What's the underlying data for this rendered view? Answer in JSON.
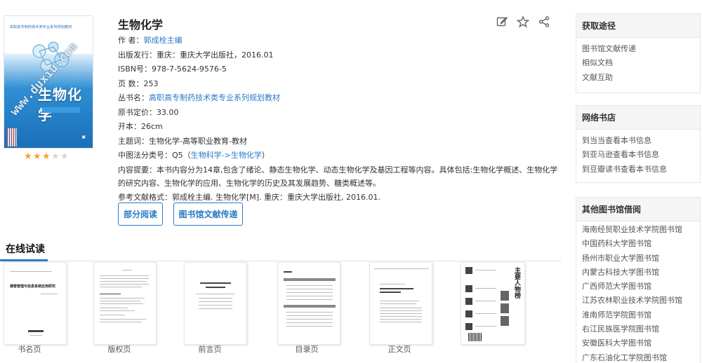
{
  "book": {
    "title": "生物化学",
    "rating": {
      "value": 3,
      "max": 5
    },
    "cover": {
      "series_text": "高职高专制药技术类专业系列规划教材",
      "title": "生物化学",
      "watermark": "www.duxiu.com"
    },
    "author": {
      "label": "作 者：",
      "value": "郭成栓主编"
    },
    "publisher": {
      "label": "出版发行：",
      "value": "重庆：重庆大学出版社，2016.01"
    },
    "isbn": {
      "label": "ISBN号：",
      "value": "978-7-5624-9576-5"
    },
    "pages": {
      "label": "页 数：",
      "value": "253"
    },
    "series": {
      "label": "丛书名：",
      "value": "高职高专制药技术类专业系列规划教材"
    },
    "price": {
      "label": "原书定价：",
      "value": "33.00"
    },
    "format": {
      "label": "开本：",
      "value": "26cm"
    },
    "subject": {
      "label": "主题词：",
      "value": "生物化学-高等职业教育-教材"
    },
    "classification": {
      "label": "中图法分类号：",
      "code": "Q5",
      "open": "（",
      "cat1": "生物科学",
      "arrow": "->",
      "cat2": "生物化学",
      "close": "）"
    },
    "summary": {
      "label": "内容提要：",
      "value": "本书内容分为14章,包含了绪论、静态生物化学、动态生物化学及基因工程等内容。具体包括:生物化学概述、生物化学的研究内容、生物化学的应用、生物化学的历史及其发展趋势、糖类概述等。"
    },
    "citation": {
      "label": "参考文献格式：",
      "value": "郭成栓主编. 生物化学[M]. 重庆：重庆大学出版社, 2016.01."
    }
  },
  "actions": {
    "edit_icon": "edit-icon",
    "favorite_icon": "star-icon",
    "share_icon": "share-icon"
  },
  "buttons": {
    "partial_read": "部分阅读",
    "library_delivery": "图书馆文献传递"
  },
  "preview": {
    "heading": "在线试读",
    "pages": [
      {
        "label": "书名页",
        "thumb_title": "钢管管理与信息系统应用研究"
      },
      {
        "label": "版权页"
      },
      {
        "label": "前言页"
      },
      {
        "label": "目录页"
      },
      {
        "label": "正文页"
      },
      {
        "label": "",
        "thumb_title": "主要人物榜"
      }
    ]
  },
  "sidebar": {
    "access": {
      "title": "获取途径",
      "links": [
        "图书馆文献传递",
        "相似文档",
        "文献互助"
      ]
    },
    "stores": {
      "title": "网络书店",
      "links": [
        "到当当查看本书信息",
        "到亚马逊查看本书信息",
        "到豆瓣读书查看本书信息"
      ]
    },
    "libraries": {
      "title": "其他图书馆借阅",
      "links": [
        "海南经贸职业技术学院图书馆",
        "中国药科大学图书馆",
        "扬州市职业大学图书馆",
        "内蒙古科技大学图书馆",
        "广西师范大学图书馆",
        "江苏农林职业技术学院图书馆",
        "淮南师范学院图书馆",
        "右江民族医学院图书馆",
        "安徽医科大学图书馆",
        "广东石油化工学院图书馆"
      ]
    }
  },
  "colors": {
    "accent": "#2a7ac8",
    "star": "#f5a623"
  }
}
